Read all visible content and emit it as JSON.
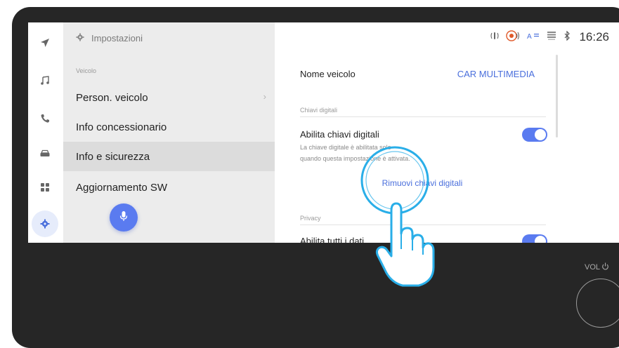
{
  "status_bar": {
    "time": "16:26"
  },
  "menu": {
    "header": "Impostazioni",
    "section": "Veicolo",
    "items": [
      {
        "label": "Person. veicolo"
      },
      {
        "label": "Info concessionario"
      },
      {
        "label": "Info e sicurezza"
      },
      {
        "label": "Aggiornamento SW"
      }
    ]
  },
  "content": {
    "vehicle_name": {
      "label": "Nome veicolo",
      "value": "CAR MULTIMEDIA"
    },
    "digital_keys": {
      "section": "Chiavi digitali",
      "toggle_label": "Abilita chiavi digitali",
      "desc_line1": "La chiave digitale è abilitata solo",
      "desc_line2": "quando questa impostazione è attivata.",
      "enabled": true,
      "remove_label": "Rimuovi chiavi digitali"
    },
    "privacy": {
      "section": "Privacy",
      "toggle_label": "Abilita tutti i dati",
      "enabled": true
    }
  },
  "hardware": {
    "vol_label": "VOL"
  },
  "colors": {
    "accent": "#5a7bf0",
    "link": "#4a6fdc",
    "touch_ring": "#29aee8",
    "bezel": "#262626"
  }
}
